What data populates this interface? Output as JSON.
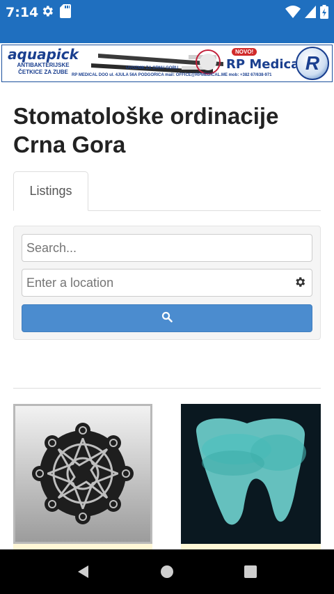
{
  "status_bar": {
    "time": "7:14",
    "left_icons": [
      "gear-icon",
      "sd-card-icon"
    ],
    "right_icons": [
      "wifi-icon",
      "signal-icon",
      "battery-charging-icon"
    ],
    "background": "#1f6fbf"
  },
  "banner": {
    "brand": "aquapick",
    "brand_sub_1": "ANTIBAKTERIJSKE",
    "brand_sub_2": "ČETKICE ZA ZUBE",
    "importer": "UVOZNIK ZA CRNU GORU",
    "address": "RP MEDICAL DOO  ul. 4JULA 56A PODGORICA  mail: OFFICE@RPMEDICAL.ME  mob: +382 67/638-971",
    "badge": "NOVO!",
    "company": "RP Medical",
    "logo_letter": "R"
  },
  "page": {
    "title": "Stomatološke ordinacije Crna Gora"
  },
  "tabs": [
    {
      "label": "Listings",
      "active": true
    }
  ],
  "search": {
    "keyword_placeholder": "Search...",
    "location_placeholder": "Enter a location",
    "button_icon": "search-icon",
    "button_color": "#4b8ccf"
  },
  "listings": [
    {
      "image": "geometric-ornament-image"
    },
    {
      "image": "teal-tooth-image"
    }
  ],
  "nav": [
    "back-icon",
    "home-icon",
    "recents-icon"
  ]
}
